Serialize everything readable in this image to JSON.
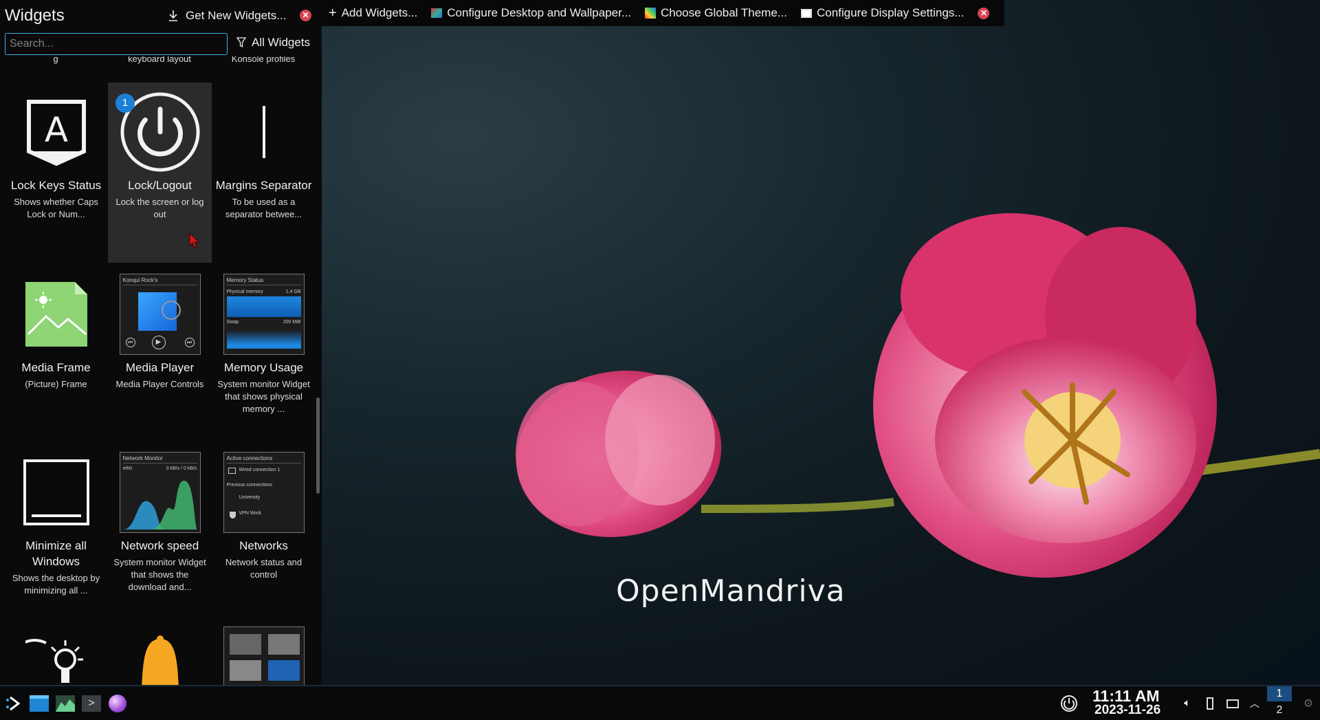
{
  "panel": {
    "title": "Widgets",
    "get_new_label": "Get New Widgets...",
    "search_placeholder": "Search...",
    "filter_label": "All Widgets",
    "partial_row": [
      "g",
      "keyboard layout",
      "Konsole profiles"
    ],
    "widgets": [
      {
        "name": "Lock Keys Status",
        "desc": "Shows whether Caps Lock or Num...",
        "icon": "lock-keys-icon"
      },
      {
        "name": "Lock/Logout",
        "desc": "Lock the screen or log out",
        "icon": "power-icon",
        "badge": "1",
        "selected": true
      },
      {
        "name": "Margins Separator",
        "desc": "To be used as a separator betwee...",
        "icon": "separator-icon"
      },
      {
        "name": "Media Frame",
        "desc": "(Picture) Frame",
        "icon": "picture-frame-icon"
      },
      {
        "name": "Media Player",
        "desc": "Media Player Controls",
        "icon": "media-player-icon",
        "preview_title": "Konqui Rock's"
      },
      {
        "name": "Memory Usage",
        "desc": "System monitor Widget that shows physical memory ...",
        "icon": "memory-usage-icon",
        "preview_title": "Memory Status",
        "preview_lines": [
          "Physical memory",
          "1,4 GB",
          "Swap",
          "200 MiB"
        ]
      },
      {
        "name": "Minimize all Windows",
        "desc": "Shows the desktop by minimizing all ...",
        "icon": "minimize-all-icon"
      },
      {
        "name": "Network speed",
        "desc": "System monitor Widget that shows the download and...",
        "icon": "network-speed-icon",
        "preview_title": "Network Monitor",
        "preview_lines": [
          "eth0",
          "0 kB/s / 0 kB/s"
        ]
      },
      {
        "name": "Networks",
        "desc": "Network status and control",
        "icon": "networks-icon",
        "preview_title": "Active connections",
        "preview_lines": [
          "Wired connection 1",
          "Previous connections",
          "University",
          "VPN Work"
        ]
      }
    ]
  },
  "toolbar": {
    "add_widgets": "Add Widgets...",
    "configure_desktop": "Configure Desktop and Wallpaper...",
    "global_theme": "Choose Global Theme...",
    "display_settings": "Configure Display Settings..."
  },
  "wallpaper": {
    "brand": "OpenMandriva"
  },
  "taskbar": {
    "time": "11:11 AM",
    "date": "2023-11-26",
    "desktops": [
      "1",
      "2"
    ]
  },
  "colors": {
    "accent": "#3daee9",
    "close": "#da4453",
    "badge": "#1d80d8",
    "pager_active": "#1c4d80"
  }
}
